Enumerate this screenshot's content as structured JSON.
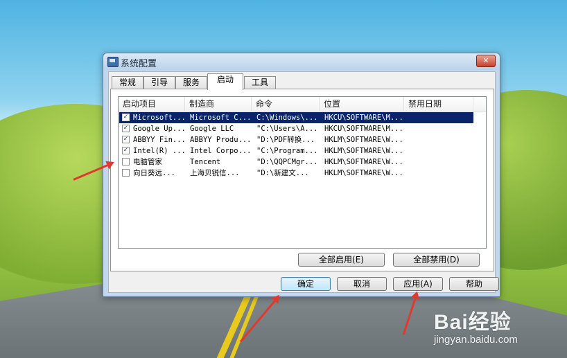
{
  "dialog": {
    "title": "系统配置",
    "close_label": "✕",
    "tabs": [
      "常规",
      "引导",
      "服务",
      "启动",
      "工具"
    ],
    "active_tab": "启动"
  },
  "startup": {
    "columns": [
      "启动项目",
      "制造商",
      "命令",
      "位置",
      "禁用日期"
    ],
    "rows": [
      {
        "checked": true,
        "item": "Microsoft...",
        "vendor": "Microsoft C...",
        "command": "C:\\Windows\\...",
        "location": "HKCU\\SOFTWARE\\M...",
        "disabled_date": "",
        "selected": true
      },
      {
        "checked": true,
        "item": "Google Up...",
        "vendor": "Google LLC",
        "command": "\"C:\\Users\\A...",
        "location": "HKCU\\SOFTWARE\\M...",
        "disabled_date": "",
        "selected": false
      },
      {
        "checked": true,
        "item": "ABBYY Fin...",
        "vendor": "ABBYY Produ...",
        "command": "\"D:\\PDF转换...",
        "location": "HKLM\\SOFTWARE\\W...",
        "disabled_date": "",
        "selected": false
      },
      {
        "checked": true,
        "item": "Intel(R) ...",
        "vendor": "Intel Corpo...",
        "command": "\"C:\\Program...",
        "location": "HKLM\\SOFTWARE\\W...",
        "disabled_date": "",
        "selected": false
      },
      {
        "checked": false,
        "item": "电脑管家",
        "vendor": "Tencent",
        "command": "\"D:\\QQPCMgr...",
        "location": "HKLM\\SOFTWARE\\W...",
        "disabled_date": "",
        "selected": false
      },
      {
        "checked": false,
        "item": "向日葵远...",
        "vendor": "上海贝锐信...",
        "command": "\"D:\\新建文...",
        "location": "HKLM\\SOFTWARE\\W...",
        "disabled_date": "",
        "selected": false
      }
    ],
    "enable_all_label": "全部启用(E)",
    "disable_all_label": "全部禁用(D)"
  },
  "footer": {
    "ok_label": "确定",
    "cancel_label": "取消",
    "apply_label": "应用(A)",
    "help_label": "帮助"
  },
  "watermark": {
    "logo": "Bai经验",
    "url": "jingyan.baidu.com"
  },
  "colors": {
    "selection": "#0a246a",
    "annotation_arrow": "#e03a2f"
  }
}
